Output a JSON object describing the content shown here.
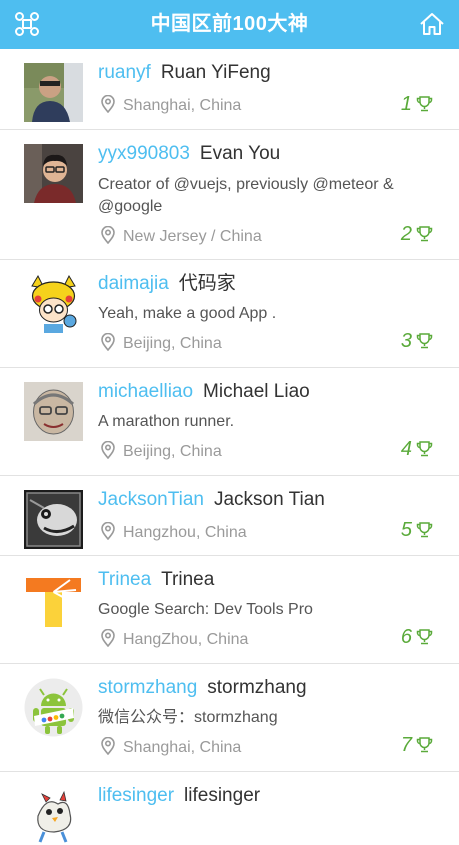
{
  "header": {
    "title": "中国区前100大神"
  },
  "users": [
    {
      "login": "ruanyf",
      "name": "Ruan YiFeng",
      "bio": "",
      "location": "Shanghai, China",
      "rank": "1"
    },
    {
      "login": "yyx990803",
      "name": "Evan You",
      "bio": "Creator of @vuejs, previously @meteor & @google",
      "location": "New Jersey / China",
      "rank": "2"
    },
    {
      "login": "daimajia",
      "name": "代码家",
      "bio": "Yeah, make a good App .",
      "location": "Beijing, China",
      "rank": "3"
    },
    {
      "login": "michaelliao",
      "name": "Michael Liao",
      "bio": "A marathon runner.",
      "location": "Beijing, China",
      "rank": "4"
    },
    {
      "login": "JacksonTian",
      "name": "Jackson Tian",
      "bio": "",
      "location": "Hangzhou, China",
      "rank": "5"
    },
    {
      "login": "Trinea",
      "name": "Trinea",
      "bio": "Google Search: Dev Tools Pro",
      "location": "HangZhou, China",
      "rank": "6"
    },
    {
      "login": "stormzhang",
      "name": "stormzhang",
      "bio": "微信公众号：stormzhang",
      "location": "Shanghai, China",
      "rank": "7"
    },
    {
      "login": "lifesinger",
      "name": "lifesinger",
      "bio": "",
      "location": "",
      "rank": ""
    }
  ],
  "icons": {
    "menu": "command-icon",
    "home": "home-icon",
    "location": "map-marker-icon",
    "rank": "trophy-icon"
  },
  "colors": {
    "header": "#4ebef0",
    "login": "#4ebef0",
    "rank": "#5aaa3a",
    "location": "#9a9a9a"
  }
}
